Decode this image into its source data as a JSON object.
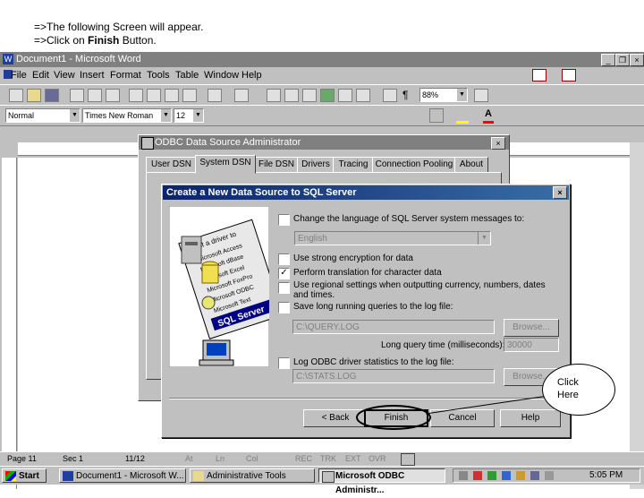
{
  "instructions": {
    "line1": "=>The following Screen will appear.",
    "line2_prefix": "=>Click on ",
    "line2_bold": "Finish",
    "line2_suffix": " Button."
  },
  "word": {
    "title": "Document1 - Microsoft Word",
    "menu": [
      "File",
      "Edit",
      "View",
      "Insert",
      "Format",
      "Tools",
      "Table",
      "Window",
      "Help"
    ],
    "style_value": "Normal",
    "font_value": "Times New Roman",
    "size_value": "12",
    "zoom_value": "88%",
    "status": {
      "page": "Page 11",
      "sec": "Sec 1",
      "count": "11/12",
      "at": "At",
      "ln": "Ln",
      "col": "Col",
      "rec": "REC",
      "trk": "TRK",
      "ext": "EXT",
      "ovr": "OVR"
    }
  },
  "odbc": {
    "title": "ODBC Data Source Administrator",
    "tabs": [
      "User DSN",
      "System DSN",
      "File DSN",
      "Drivers",
      "Tracing",
      "Connection Pooling",
      "About"
    ]
  },
  "dialog": {
    "title": "Create a New Data Source to SQL Server",
    "opt_language": "Change the language of SQL Server system messages to:",
    "language_value": "English",
    "opt_encryption": "Use strong encryption for data",
    "opt_translation": "Perform translation for character data",
    "opt_regional": "Use regional settings when outputting currency, numbers, dates and times.",
    "opt_longqueries": "Save long running queries to the log file:",
    "query_log": "C:\\QUERY.LOG",
    "browse1": "Browse...",
    "long_query_label": "Long query time (milliseconds):",
    "long_query_value": "30000",
    "opt_stats": "Log ODBC driver statistics to the log file:",
    "stats_log": "C:\\STATS.LOG",
    "browse2": "Browse...",
    "back": "< Back",
    "finish": "Finish",
    "cancel": "Cancel",
    "help": "Help",
    "translation_checked": true,
    "art_text": [
      "Select a driver to",
      "Microsoft Access",
      "Microsoft dBase",
      "Microsoft Excel",
      "Microsoft FoxPro",
      "Microsoft ODBC",
      "Microsoft Text",
      "SQL Server"
    ]
  },
  "callout": {
    "text": "Click Here"
  },
  "taskbar": {
    "start": "Start",
    "tasks": [
      "Document1 - Microsoft W...",
      "Administrative Tools",
      "Microsoft ODBC Administr..."
    ],
    "clock": "5:05 PM"
  }
}
